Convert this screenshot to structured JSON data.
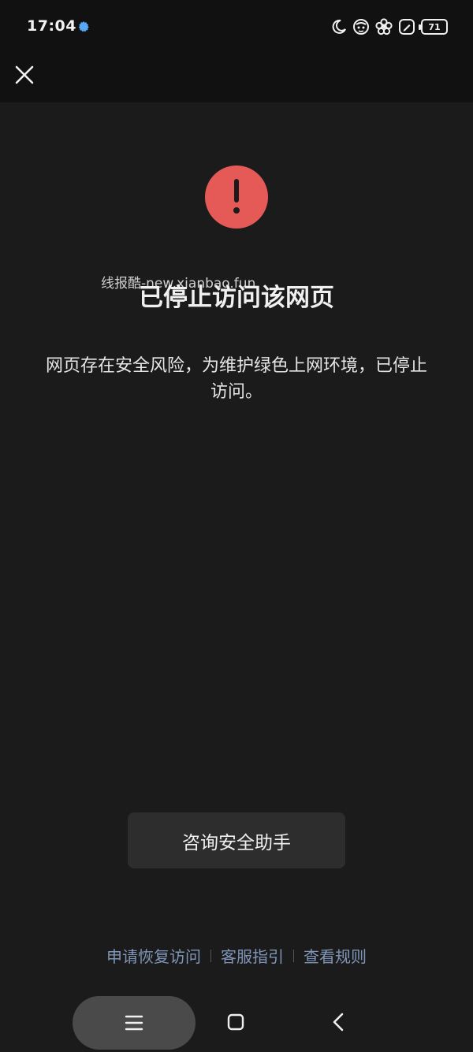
{
  "status_bar": {
    "time": "17:04",
    "battery_level": "71",
    "icons": [
      "gear-badge-icon",
      "moon-icon",
      "sheep-face-icon",
      "flower-icon",
      "stylus-icon",
      "battery-icon"
    ]
  },
  "toolbar": {
    "close_icon": "close-icon"
  },
  "warning": {
    "icon": "exclamation-icon",
    "color": "#e55a57",
    "watermark": "线报酷-new.xianbao.fun",
    "title": "已停止访问该网页",
    "description": "网页存在安全风险，为维护绿色上网环境，已停止访问。"
  },
  "actions": {
    "consult_label": "咨询安全助手"
  },
  "links": {
    "restore": "申请恢复访问",
    "support": "客服指引",
    "rules": "查看规则",
    "color": "#7f96b8"
  },
  "nav": {
    "menu_icon": "menu-icon",
    "home_icon": "home-icon",
    "back_icon": "back-icon"
  }
}
